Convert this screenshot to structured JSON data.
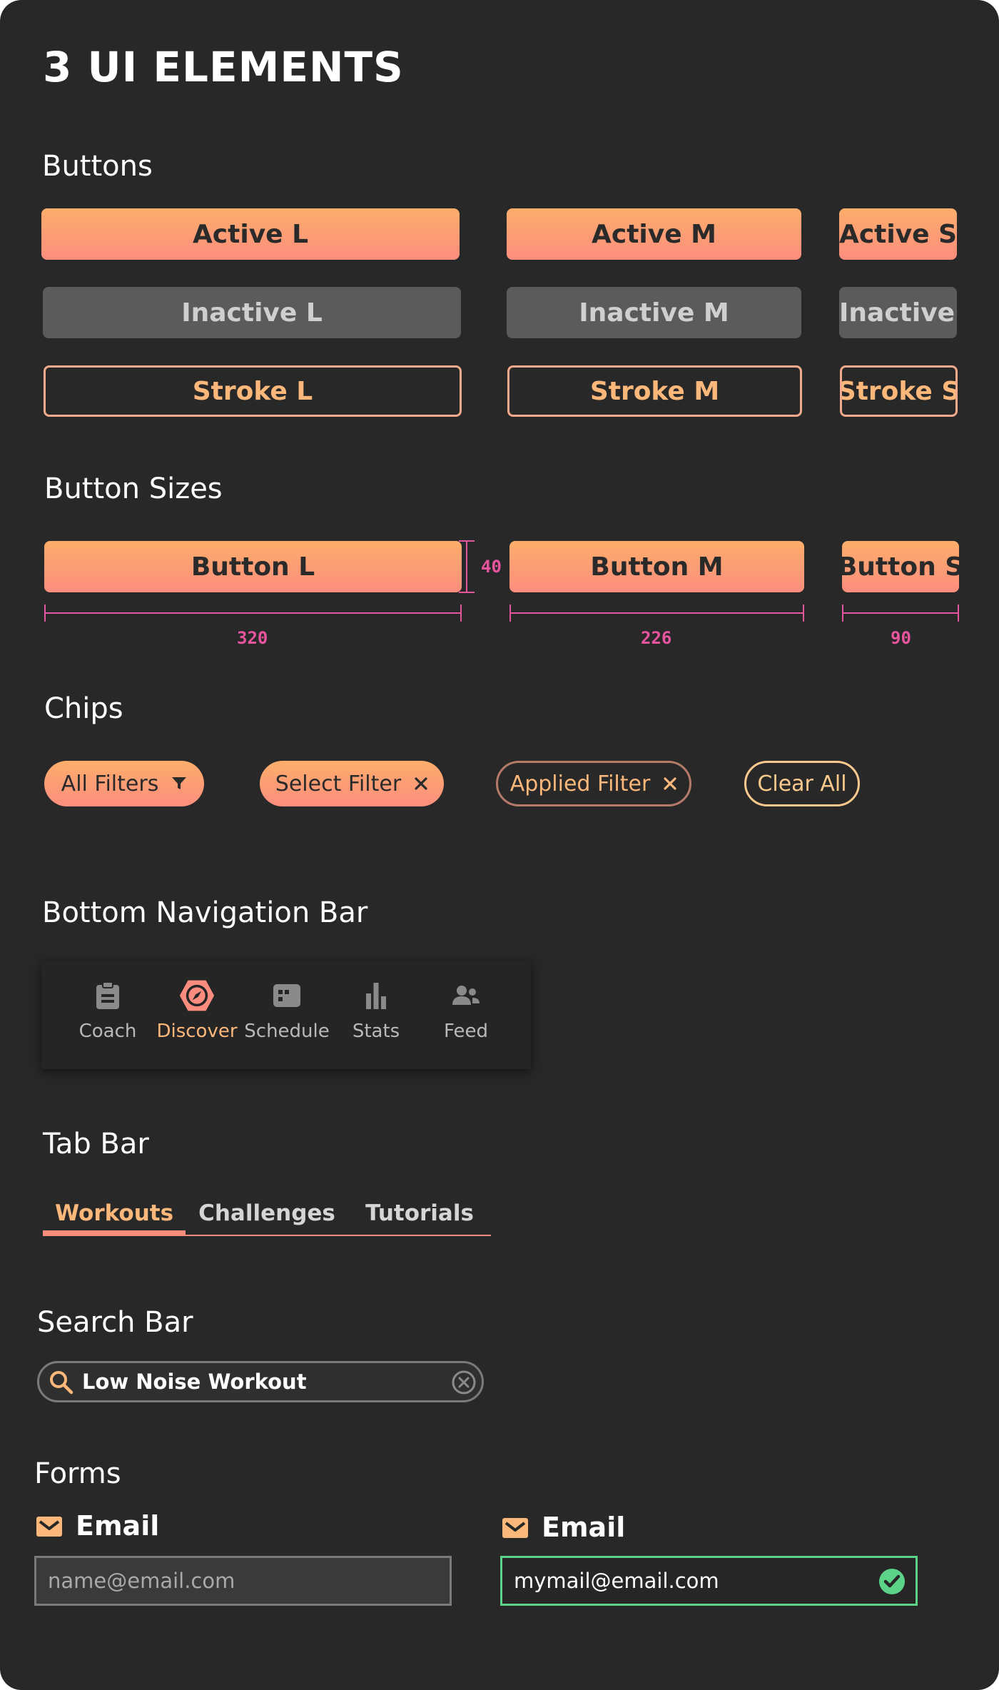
{
  "page": {
    "title": "3 UI ELEMENTS"
  },
  "buttons": {
    "heading": "Buttons",
    "active": {
      "large": "Active L",
      "medium": "Active M",
      "small": "Active S"
    },
    "inactive": {
      "large": "Inactive L",
      "medium": "Inactive M",
      "small": "Inactive S"
    },
    "stroke": {
      "large": "Stroke L",
      "medium": "Stroke M",
      "small": "Stroke S"
    }
  },
  "button_sizes": {
    "heading": "Button Sizes",
    "large_label": "Button L",
    "medium_label": "Button M",
    "small_label": "Button S",
    "height_value": "40",
    "large_width": "320",
    "medium_width": "226",
    "small_width": "90"
  },
  "chips": {
    "heading": "Chips",
    "all_filters": "All Filters",
    "select_filter": "Select Filter",
    "applied_filter": "Applied Filter",
    "clear_all": "Clear All"
  },
  "bottom_nav": {
    "heading": "Bottom Navigation Bar",
    "items": [
      {
        "label": "Coach",
        "icon": "clipboard-icon",
        "active": false
      },
      {
        "label": "Discover",
        "icon": "compass-icon",
        "active": true
      },
      {
        "label": "Schedule",
        "icon": "schedule-icon",
        "active": false
      },
      {
        "label": "Stats",
        "icon": "bar-chart-icon",
        "active": false
      },
      {
        "label": "Feed",
        "icon": "people-icon",
        "active": false
      }
    ]
  },
  "tab_bar": {
    "heading": "Tab Bar",
    "tabs": [
      {
        "label": "Workouts",
        "active": true
      },
      {
        "label": "Challenges",
        "active": false
      },
      {
        "label": "Tutorials",
        "active": false
      }
    ]
  },
  "search_bar": {
    "heading": "Search Bar",
    "value": "Low Noise Workout"
  },
  "forms": {
    "heading": "Forms",
    "field1": {
      "label": "Email",
      "placeholder": "name@email.com"
    },
    "field2": {
      "label": "Email",
      "value": "mymail@email.com",
      "state": "valid"
    }
  },
  "colors": {
    "background": "#282828",
    "accent_start": "#fdae6b",
    "accent_end": "#fc8d7e",
    "inactive": "#5b5b5b",
    "dimension": "#e8559f",
    "success": "#5dd38a"
  }
}
